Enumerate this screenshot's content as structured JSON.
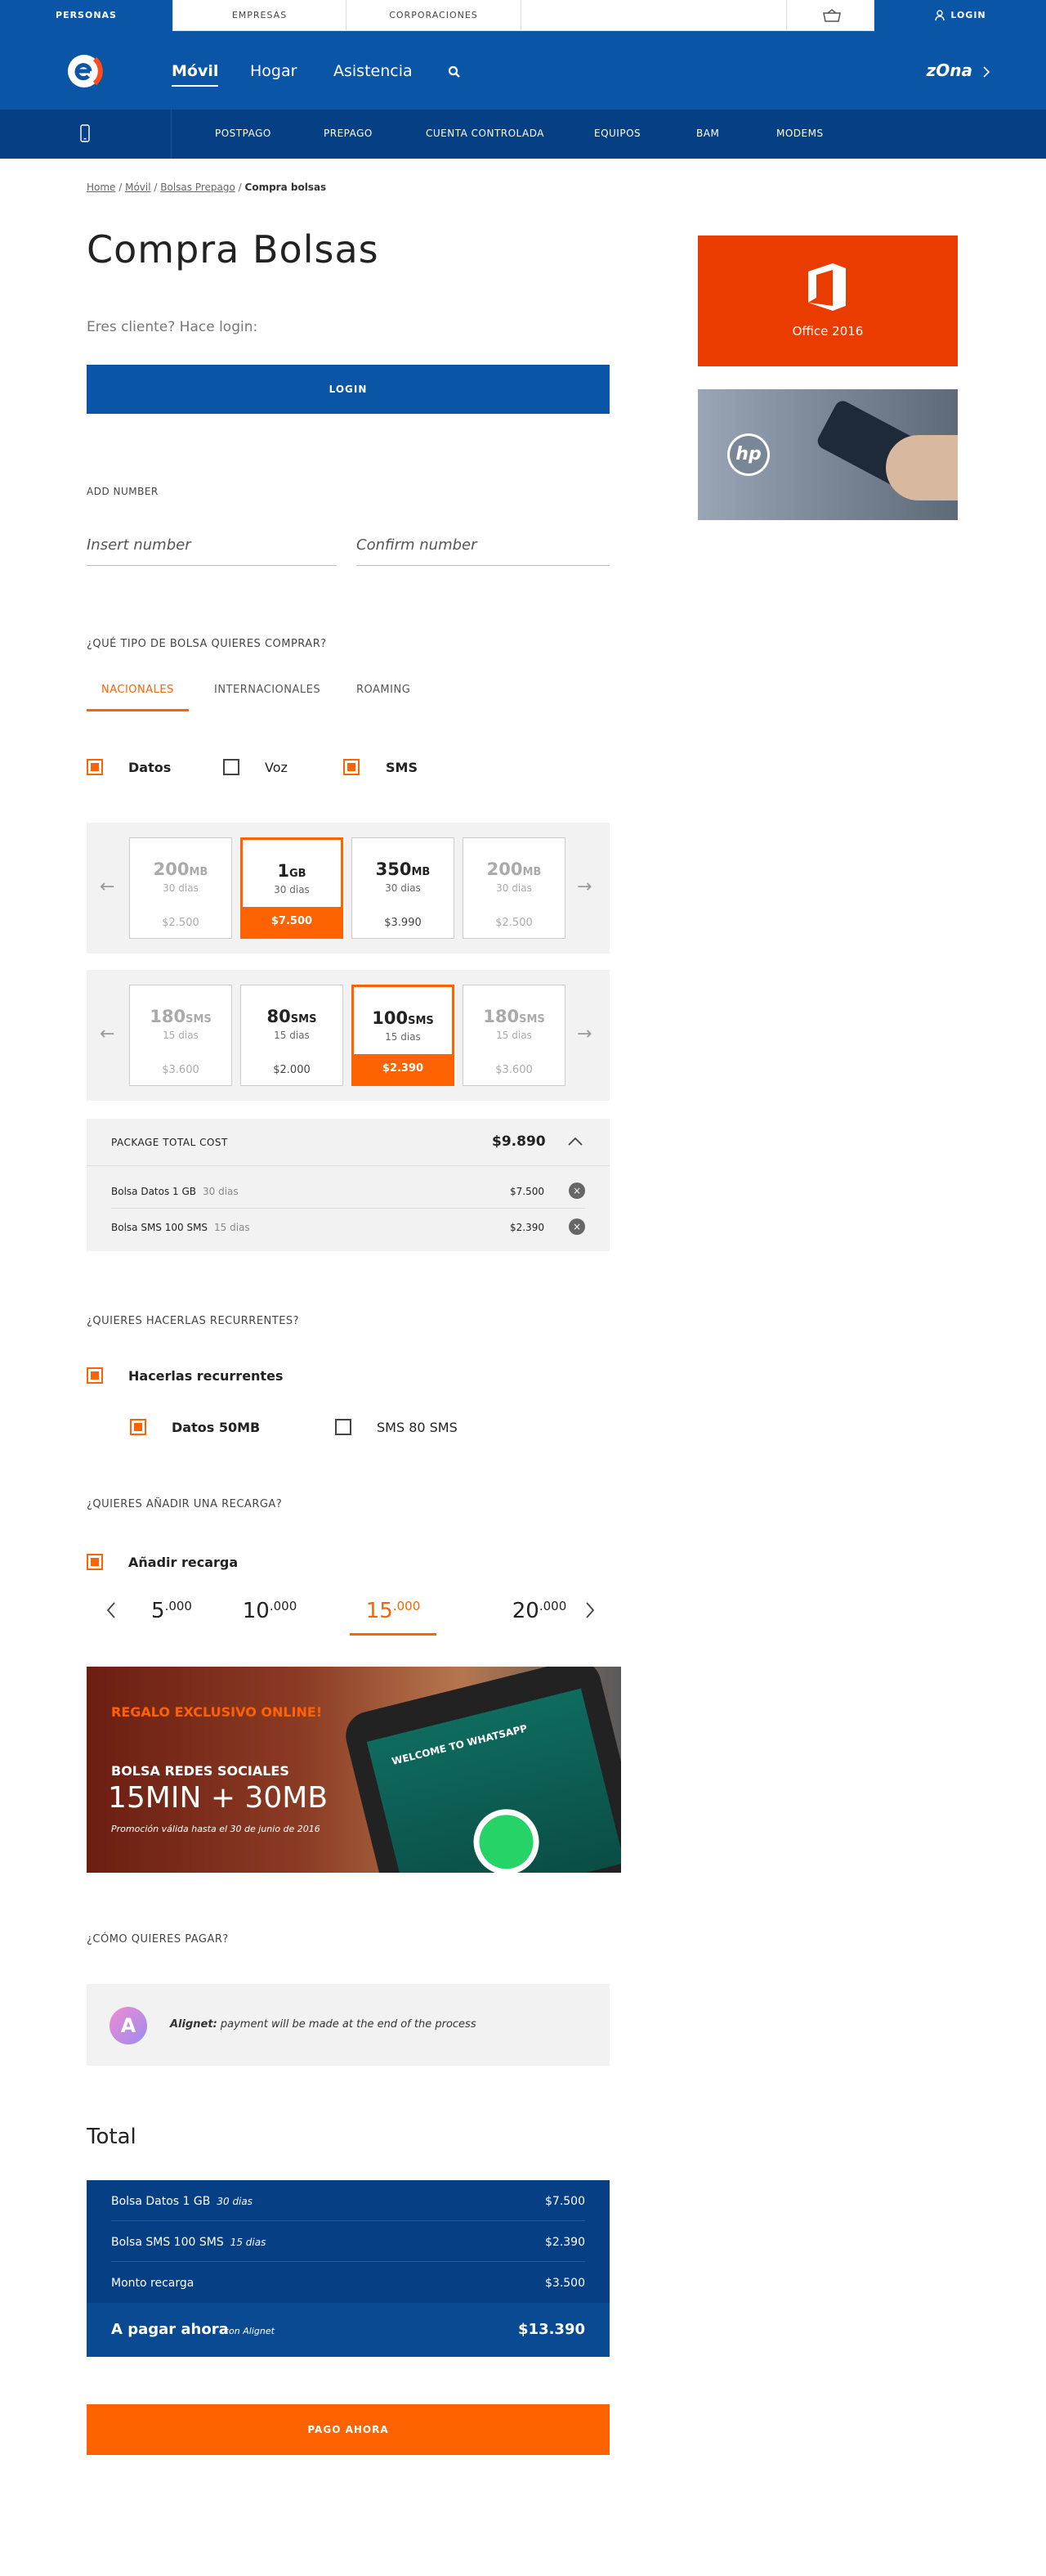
{
  "topstrip": {
    "tabs": [
      "PERSONAS",
      "EMPRESAS",
      "CORPORACIONES"
    ],
    "login": "LOGIN"
  },
  "mainnav": {
    "links": [
      "Móvil",
      "Hogar",
      "Asistencia"
    ],
    "zona": "zOna"
  },
  "subnav": {
    "items": [
      "POSTPAGO",
      "PREPAGO",
      "CUENTA CONTROLADA",
      "EQUIPOS",
      "BAM",
      "MODEMS"
    ]
  },
  "breadcrumb": {
    "items": [
      "Home",
      "Móvil",
      "Bolsas Prepago"
    ],
    "current": "Compra bolsas",
    "sep": " / "
  },
  "page": {
    "title": "Compra Bolsas",
    "login_prompt": "Eres cliente? Hace login:",
    "login_button": "LOGIN"
  },
  "add_number": {
    "label": "ADD NUMBER",
    "insert_placeholder": "Insert number",
    "confirm_placeholder": "Confirm number"
  },
  "tipo": {
    "question": "¿QUÉ TIPO DE BOLSA QUIERES COMPRAR?",
    "tabs": [
      "NACIONALES",
      "INTERNACIONALES",
      "ROAMING"
    ],
    "checkboxes": [
      {
        "label": "Datos",
        "checked": true
      },
      {
        "label": "Voz",
        "checked": false
      },
      {
        "label": "SMS",
        "checked": true
      }
    ]
  },
  "data_cards": [
    {
      "amount": "200",
      "unit": "MB",
      "duration": "30 dias",
      "price": "$2.500",
      "state": "dim"
    },
    {
      "amount": "1",
      "unit": "GB",
      "duration": "30 dias",
      "price": "$7.500",
      "state": "selected"
    },
    {
      "amount": "350",
      "unit": "MB",
      "duration": "30 dias",
      "price": "$3.990",
      "state": "normal"
    },
    {
      "amount": "200",
      "unit": "MB",
      "duration": "30 dias",
      "price": "$2.500",
      "state": "dim"
    }
  ],
  "sms_cards": [
    {
      "amount": "180",
      "unit": "SMS",
      "duration": "15 dias",
      "price": "$3.600",
      "state": "dim"
    },
    {
      "amount": "80",
      "unit": "SMS",
      "duration": "15 dias",
      "price": "$2.000",
      "state": "normal"
    },
    {
      "amount": "100",
      "unit": "SMS",
      "duration": "15 dias",
      "price": "$2.390",
      "state": "selected"
    },
    {
      "amount": "180",
      "unit": "SMS",
      "duration": "15 dias",
      "price": "$3.600",
      "state": "dim"
    }
  ],
  "package": {
    "label": "PACKAGE TOTAL COST",
    "total": "$9.890",
    "rows": [
      {
        "name": "Bolsa Datos 1 GB",
        "duration": "30 dias",
        "price": "$7.500"
      },
      {
        "name": "Bolsa SMS 100 SMS",
        "duration": "15 dias",
        "price": "$2.390"
      }
    ]
  },
  "recurrentes": {
    "question": "¿QUIERES HACERLAS RECURRENTES?",
    "main_label": "Hacerlas recurrentes",
    "options": [
      {
        "label": "Datos 50MB",
        "checked": true
      },
      {
        "label": "SMS 80 SMS",
        "checked": false
      }
    ]
  },
  "recarga": {
    "question": "¿QUIERES AÑADIR UNA RECARGA?",
    "label": "Añadir recarga",
    "amounts": [
      {
        "main": "5",
        "dec": ".000"
      },
      {
        "main": "10",
        "dec": ".000"
      },
      {
        "main": "15",
        "dec": ".000"
      },
      {
        "main": "20",
        "dec": ".000"
      }
    ],
    "selected_index": 2
  },
  "promo": {
    "tag": "REGALO EXCLUSIVO ONLINE!",
    "title": "BOLSA REDES SOCIALES",
    "headline": "15MIN + 30MB",
    "note": "Promoción válida hasta el 30 de junio de 2016",
    "screen_text": "WELCOME TO WHATSAPP"
  },
  "sidebar": {
    "office_label": "Office 2016",
    "hp_label": "hp"
  },
  "pago": {
    "question": "¿CÓMO QUIERES PAGAR?",
    "provider": "Alignet:",
    "description": " payment will be made at the end of the process"
  },
  "total": {
    "title": "Total",
    "rows": [
      {
        "name": "Bolsa Datos 1 GB",
        "duration": "30 dias",
        "price": "$7.500"
      },
      {
        "name": "Bolsa SMS 100 SMS",
        "duration": "15 dias",
        "price": "$2.390"
      },
      {
        "name": "Monto recarga",
        "duration": "",
        "price": "$3.500"
      }
    ],
    "pay_now": "A pagar ahora",
    "pay_via": "con Alignet",
    "pay_amount": "$13.390",
    "button": "PAGO AHORA"
  },
  "colors": {
    "brand_blue": "#0a55a6",
    "dark_blue": "#063f84",
    "accent_orange": "#ff6200",
    "office_orange": "#eb3c00"
  }
}
